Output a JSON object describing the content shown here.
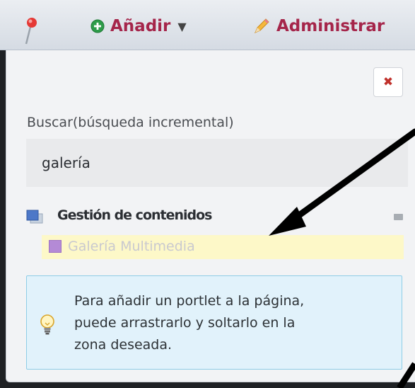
{
  "toolbar": {
    "add_label": "Añadir",
    "add_caret": "▼",
    "manage_label": "Administrar"
  },
  "panel": {
    "close_label": "✖",
    "search_label": "Buscar(búsqueda incremental)",
    "search_value": "galería",
    "category": {
      "label": "Gestión de contenidos",
      "items": [
        {
          "label": "Galería Multimedia"
        }
      ]
    },
    "info_text": "Para añadir un portlet a la página,\npuede arrastrarlo y soltarlo en la\nzona deseada."
  },
  "colors": {
    "accent": "#a5254a",
    "highlight": "#fdf8c8",
    "info_bg": "#e1f2fb",
    "info_border": "#8fcde7"
  },
  "icons": [
    "pin-icon",
    "add-circle-icon",
    "pencil-icon",
    "close-icon",
    "portlet-category-icon",
    "collapse-icon",
    "portlet-icon",
    "lightbulb-icon"
  ]
}
